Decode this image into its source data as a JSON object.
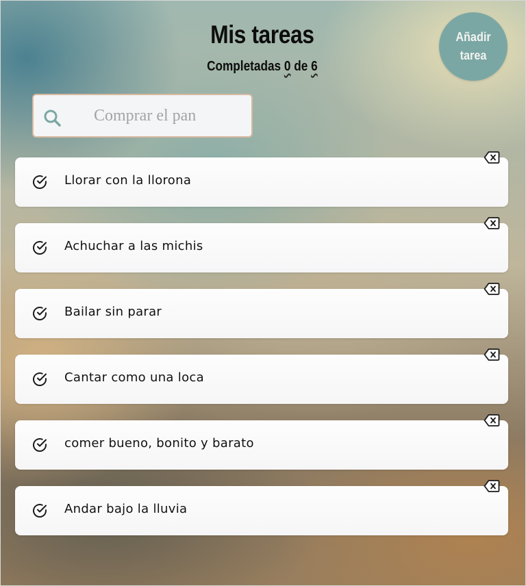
{
  "header": {
    "title": "Mis tareas",
    "counter": {
      "prefix": "Completadas",
      "completed": "0",
      "middle": "de",
      "total": "6"
    }
  },
  "add_button": {
    "label": "Añadir tarea",
    "color": "#7aa7a4"
  },
  "search": {
    "placeholder": "Comprar el pan",
    "icon": "search-icon",
    "icon_color": "#7aa7a4"
  },
  "tasks": [
    {
      "text": "Llorar con la llorona"
    },
    {
      "text": "Achuchar a las michis"
    },
    {
      "text": "Bailar sin parar"
    },
    {
      "text": "Cantar como una loca"
    },
    {
      "text": "comer bueno, bonito y barato"
    },
    {
      "text": "Andar bajo la lluvia"
    }
  ],
  "icons": {
    "check": "check-circle-icon",
    "delete": "backspace-delete-icon"
  }
}
